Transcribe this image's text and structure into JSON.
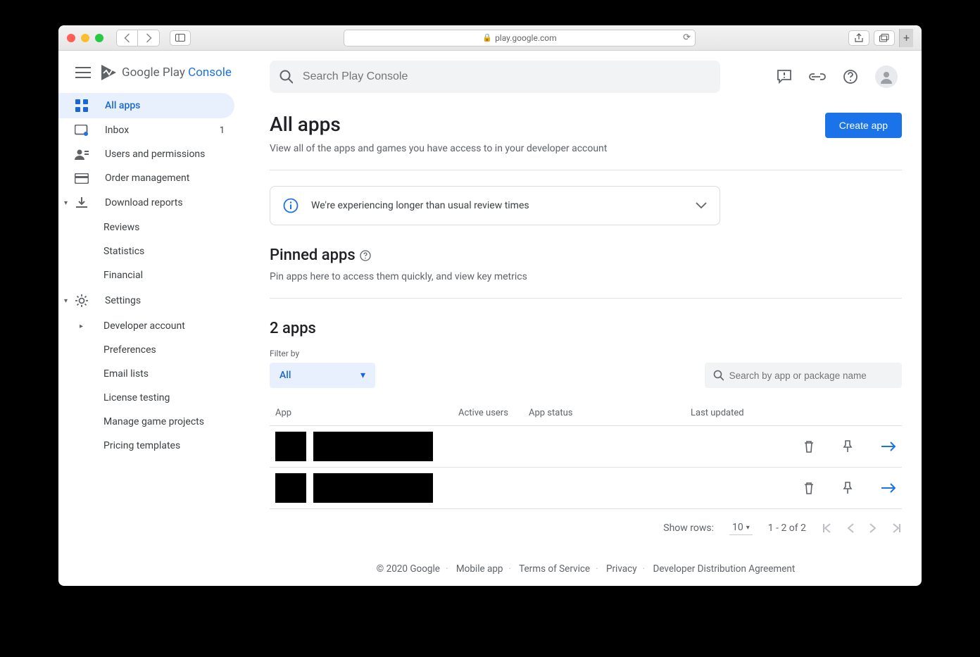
{
  "browser": {
    "url": "play.google.com"
  },
  "brand": {
    "name_a": "Google Play ",
    "name_b": "Console"
  },
  "search": {
    "placeholder": "Search Play Console"
  },
  "sidebar": {
    "items": [
      {
        "label": "All apps"
      },
      {
        "label": "Inbox",
        "badge": "1"
      },
      {
        "label": "Users and permissions"
      },
      {
        "label": "Order management"
      },
      {
        "label": "Download reports"
      },
      {
        "label": "Reviews"
      },
      {
        "label": "Statistics"
      },
      {
        "label": "Financial"
      },
      {
        "label": "Settings"
      },
      {
        "label": "Developer account"
      },
      {
        "label": "Preferences"
      },
      {
        "label": "Email lists"
      },
      {
        "label": "License testing"
      },
      {
        "label": "Manage game projects"
      },
      {
        "label": "Pricing templates"
      }
    ]
  },
  "page": {
    "title": "All apps",
    "subtitle": "View all of the apps and games you have access to in your developer account",
    "create_btn": "Create app"
  },
  "notice": {
    "text": "We're experiencing longer than usual review times"
  },
  "pinned": {
    "title": "Pinned apps",
    "subtitle": "Pin apps here to access them quickly, and view key metrics"
  },
  "apps_section": {
    "heading": "2 apps",
    "filter_label": "Filter by",
    "filter_value": "All",
    "search_placeholder": "Search by app or package name",
    "cols": {
      "c1": "App",
      "c2": "Active users",
      "c3": "App status",
      "c4": "Last updated"
    }
  },
  "pager": {
    "show_rows": "Show rows:",
    "rows_value": "10",
    "range": "1 - 2 of 2"
  },
  "footer": {
    "copyright": "© 2020 Google",
    "l1": "Mobile app",
    "l2": "Terms of Service",
    "l3": "Privacy",
    "l4": "Developer Distribution Agreement"
  }
}
